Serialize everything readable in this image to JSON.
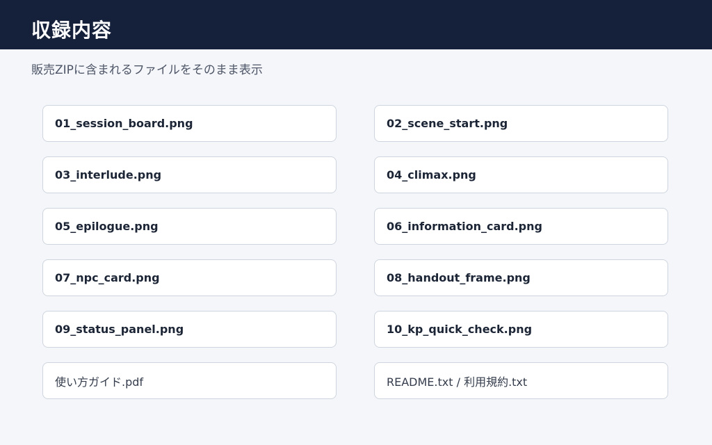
{
  "header": {
    "title": "収録内容",
    "background": "#15213a"
  },
  "subtitle": "販売ZIPに含まれるファイルをそのまま表示",
  "files": [
    {
      "name": "01_session_board.png",
      "weight": "bold"
    },
    {
      "name": "02_scene_start.png",
      "weight": "bold"
    },
    {
      "name": "03_interlude.png",
      "weight": "bold"
    },
    {
      "name": "04_climax.png",
      "weight": "bold"
    },
    {
      "name": "05_epilogue.png",
      "weight": "bold"
    },
    {
      "name": "06_information_card.png",
      "weight": "bold"
    },
    {
      "name": "07_npc_card.png",
      "weight": "bold"
    },
    {
      "name": "08_handout_frame.png",
      "weight": "bold"
    },
    {
      "name": "09_status_panel.png",
      "weight": "bold"
    },
    {
      "name": "10_kp_quick_check.png",
      "weight": "bold"
    },
    {
      "name": "使い方ガイド.pdf",
      "weight": "regular"
    },
    {
      "name": "README.txt / 利用規約.txt",
      "weight": "regular"
    }
  ]
}
